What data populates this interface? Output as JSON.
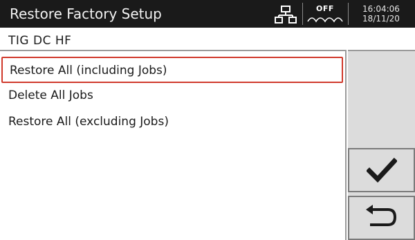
{
  "header": {
    "title": "Restore Factory Setup",
    "status": {
      "off_label": "OFF"
    },
    "clock": {
      "time": "16:04:06",
      "date": "18/11/20"
    }
  },
  "process_label": "TIG DC HF",
  "menu": {
    "items": [
      {
        "label": "Restore All (including Jobs)",
        "selected": true
      },
      {
        "label": "Delete All Jobs",
        "selected": false
      },
      {
        "label": "Restore All (excluding Jobs)",
        "selected": false
      }
    ]
  },
  "buttons": {
    "confirm_icon": "checkmark-icon",
    "back_icon": "return-arrow-icon"
  },
  "colors": {
    "titlebar": "#1a1a1a",
    "selection_border": "#d0392b",
    "side_panel": "#dcdcdc"
  }
}
